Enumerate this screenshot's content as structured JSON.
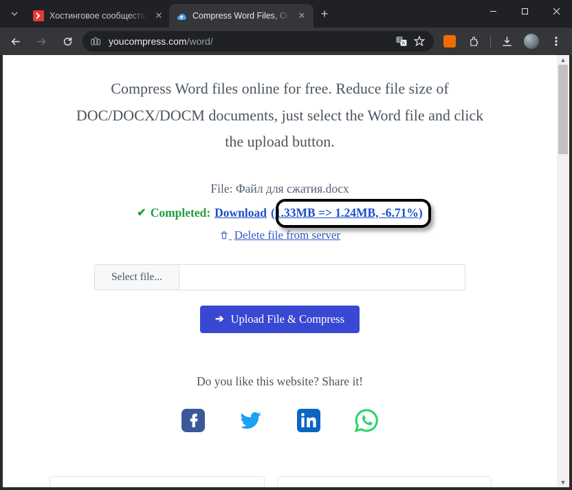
{
  "browser": {
    "tabs": [
      {
        "title": "Хостинговое сообщество «Tim",
        "active": false
      },
      {
        "title": "Compress Word Files, Online D…",
        "active": true
      }
    ],
    "url_host": "youcompress.com",
    "url_path": "/word/"
  },
  "page": {
    "headline": "Compress Word files online for free. Reduce file size of DOC/DOCX/DOCM documents, just select the Word file and click the upload button.",
    "file_label_prefix": "File: ",
    "file_name": "Файл для сжатия.docx",
    "completed_label": "Completed:",
    "download_label": "Download",
    "size_info": "(1.33MB => 1.24MB, -6.71%)",
    "delete_label": " Delete file from server",
    "select_file_label": "Select file...",
    "upload_button": "Upload File & Compress",
    "share_prompt": "Do you like this website? Share it!"
  }
}
